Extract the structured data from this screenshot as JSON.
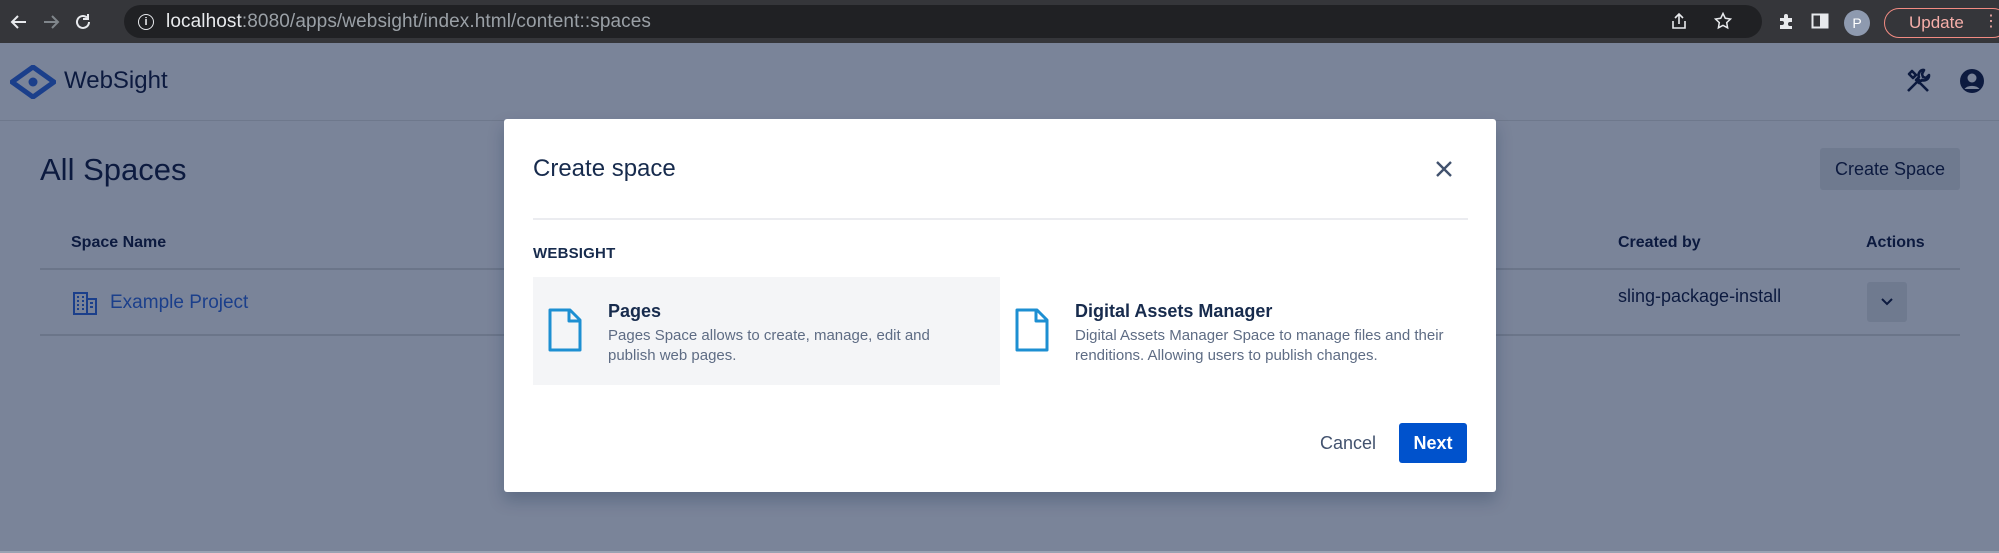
{
  "browser": {
    "url_host": "localhost",
    "url_path": ":8080/apps/websight/index.html/content::spaces",
    "profile_initial": "P",
    "update_label": "Update",
    "update_dots": "⋮"
  },
  "app": {
    "brand": "WebSight"
  },
  "page": {
    "title": "All Spaces",
    "create_button": "Create Space",
    "columns": {
      "space_name": "Space Name",
      "created_by": "Created by",
      "actions": "Actions"
    },
    "rows": [
      {
        "name": "Example Project",
        "created_by": "sling-package-install"
      }
    ]
  },
  "modal": {
    "title": "Create space",
    "section_label": "WEBSIGHT",
    "options": [
      {
        "title": "Pages",
        "description": "Pages Space allows to create, manage, edit and publish web pages.",
        "selected": true
      },
      {
        "title": "Digital Assets Manager",
        "description": "Digital Assets Manager Space to manage files and their renditions. Allowing users to publish changes.",
        "selected": false
      }
    ],
    "cancel_label": "Cancel",
    "next_label": "Next"
  },
  "colors": {
    "overlay_bg": "#7a8499",
    "primary": "#0052cc",
    "icon_blue": "#1d8fd2",
    "text_dark": "#172b4d"
  }
}
